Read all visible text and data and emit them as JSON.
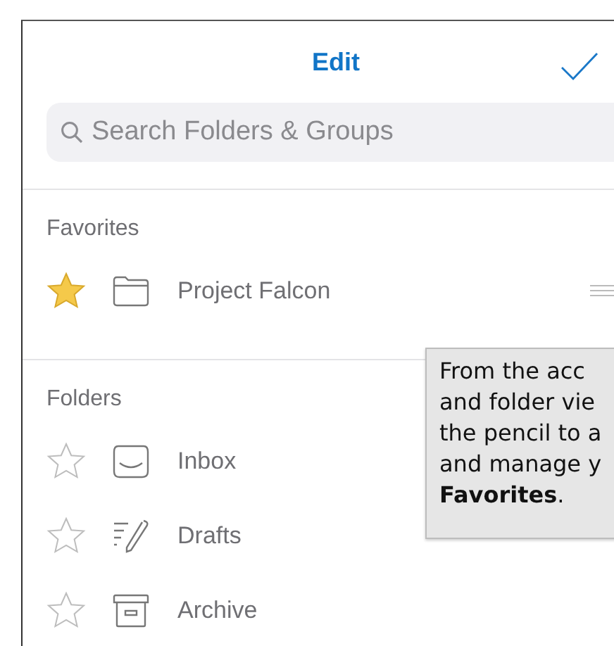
{
  "header": {
    "title": "Edit"
  },
  "search": {
    "placeholder": "Search Folders & Groups"
  },
  "sections": [
    {
      "title": "Favorites",
      "items": [
        {
          "label": "Project Falcon",
          "kind": "folder",
          "starred": true,
          "reorderable": true
        }
      ]
    },
    {
      "title": "Folders",
      "items": [
        {
          "label": "Inbox",
          "kind": "inbox",
          "starred": false,
          "reorderable": false
        },
        {
          "label": "Drafts",
          "kind": "drafts",
          "starred": false,
          "reorderable": false
        },
        {
          "label": "Archive",
          "kind": "archive",
          "starred": false,
          "reorderable": false
        }
      ]
    }
  ],
  "tooltip": {
    "lines": [
      "From the acc",
      "and folder vie",
      "the pencil to a",
      "and manage y",
      "**Favorites**."
    ]
  }
}
